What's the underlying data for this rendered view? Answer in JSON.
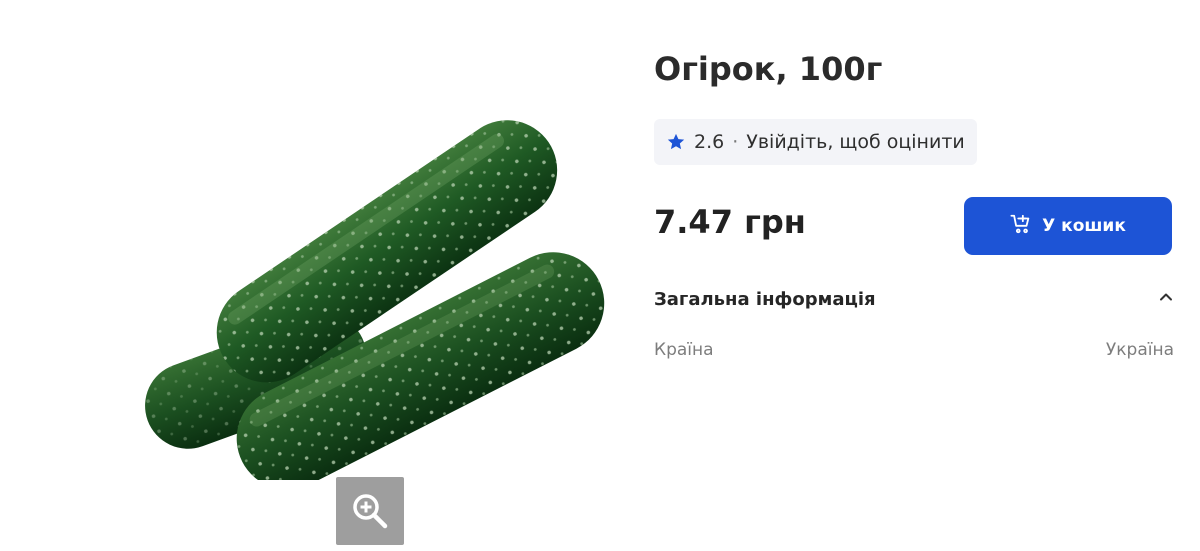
{
  "product": {
    "title": "Огірок, 100г",
    "image_alt": "cucumber-product-image",
    "zoom_icon": "zoom-in-icon"
  },
  "rating": {
    "star_icon": "star-icon",
    "star_color": "#1d54d6",
    "value": "2.6",
    "separator": "·",
    "login_prompt": "Увійдіть, щоб оцінити"
  },
  "price": {
    "text": "7.47 грн"
  },
  "cart": {
    "icon": "cart-add-icon",
    "label": "У кошик",
    "color": "#1d54d6"
  },
  "general_info": {
    "title": "Загальна інформація",
    "toggle_icon": "chevron-up-icon",
    "rows": [
      {
        "label": "Країна",
        "value": "Україна"
      }
    ]
  }
}
